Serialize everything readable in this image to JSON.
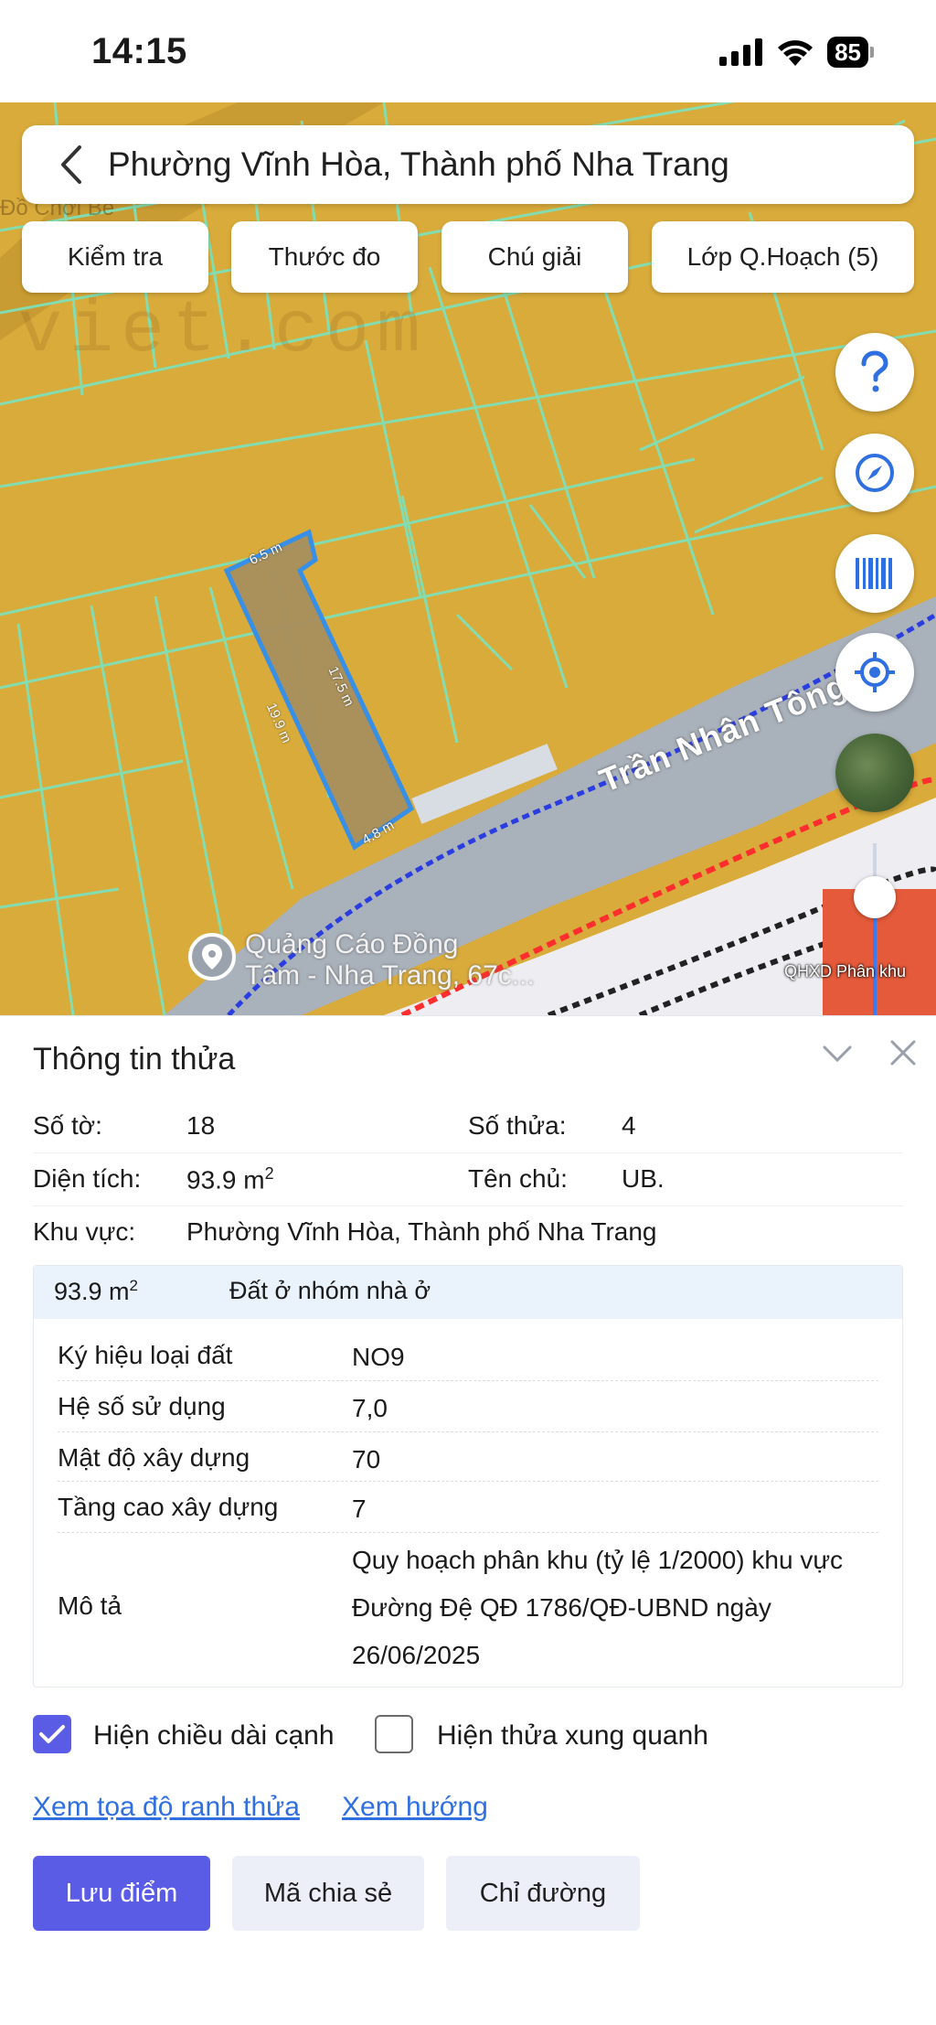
{
  "status_bar": {
    "time": "14:15",
    "battery": "85"
  },
  "search": {
    "title": "Phường Vĩnh Hòa, Thành phố Nha Trang"
  },
  "toolbar": {
    "items": [
      "Kiểm tra",
      "Thước đo",
      "Chú giải",
      "Lớp Q.Hoạch (5)"
    ]
  },
  "map": {
    "street_name": "Trần Nhân Tông",
    "poi_name": "Quảng Cáo Đồng",
    "poi_name_line2": "Tâm - Nha Trang, 67c...",
    "watermark": "viet.com",
    "place_fragment": "Đồ Chơi Bé",
    "edge_top": "6.5 m",
    "edge_right": "17.5 m",
    "edge_left": "19.9 m",
    "edge_bottom": "4.8 m",
    "layer_label": "QHXD Phân khu",
    "colors": {
      "land": "#d9ab3a",
      "parcel_outline": "#2f8ef0",
      "road": "#a9b1bb"
    }
  },
  "panel": {
    "title": "Thông tin thửa",
    "so_to_label": "Số tờ:",
    "so_to_value": "18",
    "so_thua_label": "Số thửa:",
    "so_thua_value": "4",
    "dien_tich_label": "Diện tích:",
    "dien_tich_value": "93.9 m",
    "ten_chu_label": "Tên chủ:",
    "ten_chu_value": "UB.",
    "khu_vuc_label": "Khu vực:",
    "khu_vuc_value": "Phường Vĩnh Hòa, Thành phố Nha Trang",
    "unit_exponent": "2"
  },
  "plan": {
    "area": "93.9 m",
    "land_use": "Đất ở nhóm nhà ở",
    "rows": [
      {
        "key": "Ký hiệu loại đất",
        "value": "NO9"
      },
      {
        "key": "Hệ số sử dụng",
        "value": "7,0"
      },
      {
        "key": "Mật độ xây dựng",
        "value": "70"
      },
      {
        "key": "Tầng cao xây dựng",
        "value": "7"
      }
    ],
    "desc_key": "Mô tả",
    "desc_value": "Quy hoạch phân khu (tỷ lệ 1/2000) khu vực Đường Đệ QĐ 1786/QĐ-UBND ngày 26/06/2025"
  },
  "options": {
    "show_edges": {
      "label": "Hiện chiều dài cạnh",
      "checked": true
    },
    "show_neighbors": {
      "label": "Hiện thửa xung quanh",
      "checked": false
    }
  },
  "links": {
    "coords": "Xem tọa độ ranh thửa",
    "direction": "Xem hướng"
  },
  "actions": {
    "save": "Lưu điểm",
    "share": "Mã chia sẻ",
    "route": "Chỉ đường"
  }
}
